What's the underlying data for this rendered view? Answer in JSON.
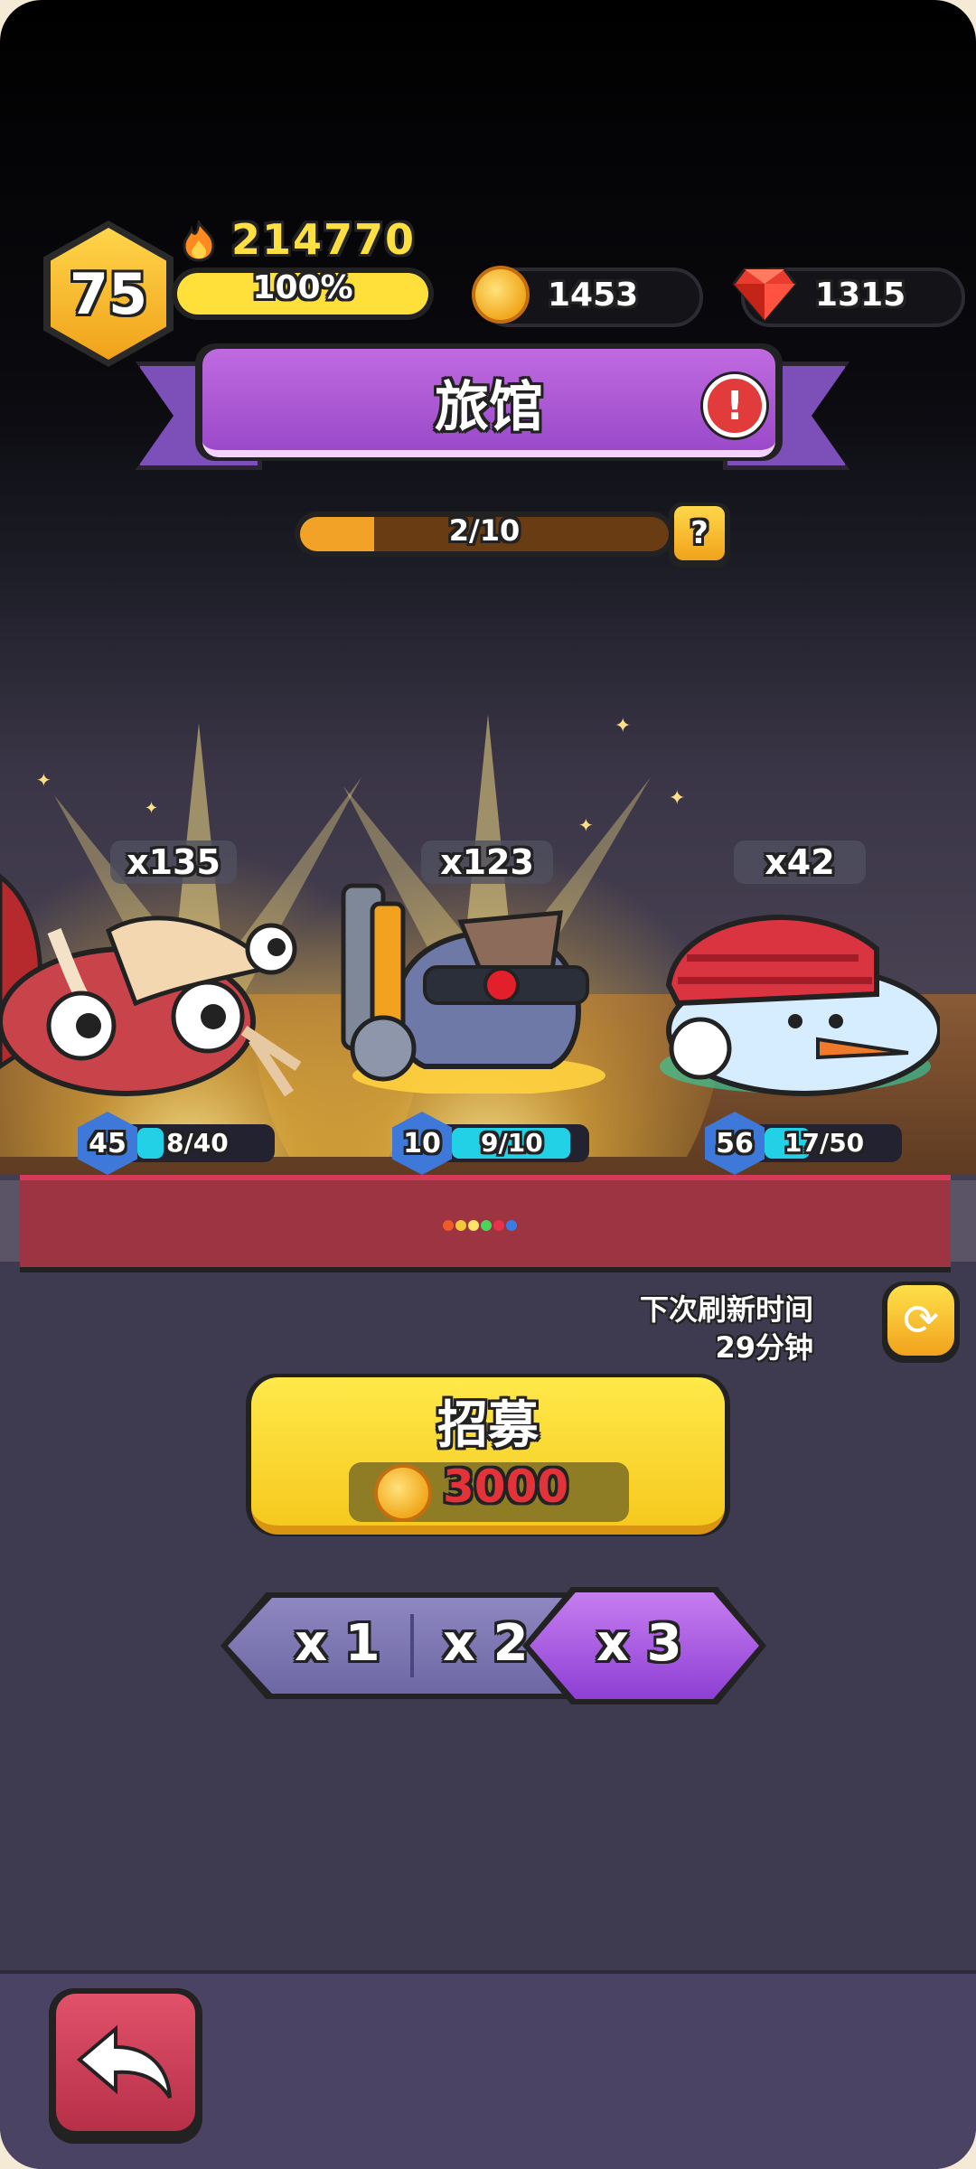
{
  "hud": {
    "level": "75",
    "power": "214770",
    "xp_percent_label": "100%",
    "xp_fraction": 1.0,
    "coins": "1453",
    "gems": "1315"
  },
  "title": {
    "label": "旅馆",
    "alert_icon": "exclamation-icon"
  },
  "progress": {
    "label": "2/10",
    "value": 2,
    "max": 10,
    "help_label": "?"
  },
  "heroes": [
    {
      "count": "x135",
      "level": "45",
      "shards": "8/40",
      "fraction": 0.2
    },
    {
      "count": "x123",
      "level": "10",
      "shards": "9/10",
      "fraction": 0.9
    },
    {
      "count": "x42",
      "level": "56",
      "shards": "17/50",
      "fraction": 0.34
    }
  ],
  "refresh": {
    "line1": "下次刷新时间",
    "line2": "29分钟"
  },
  "recruit": {
    "label": "招募",
    "cost": "3000"
  },
  "multipliers": {
    "options": [
      "x 1",
      "x 2",
      "x 3"
    ],
    "selected": "x 3"
  },
  "colors": {
    "accent_purple": "#9a4ac9",
    "gold": "#ffe043",
    "cost_red": "#e2323a",
    "bar_cyan": "#22d1e6"
  }
}
